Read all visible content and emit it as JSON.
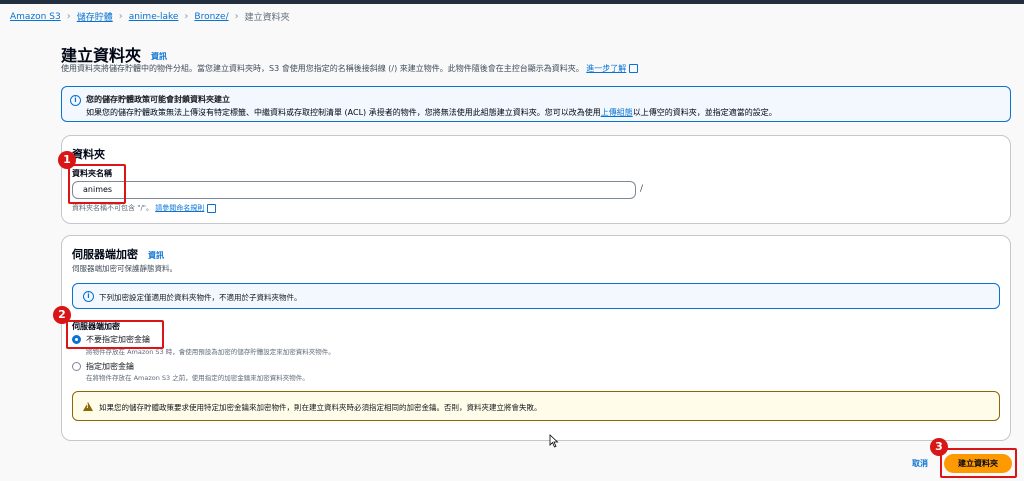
{
  "breadcrumb": {
    "items": [
      "Amazon S3",
      "儲存貯體",
      "anime-lake",
      "Bronze/"
    ],
    "current": "建立資料夾"
  },
  "header": {
    "title": "建立資料夾",
    "info": "資訊",
    "description": "使用資料夾將儲存貯體中的物件分組。當您建立資料夾時，S3 會使用您指定的名稱後接斜線 (/) 來建立物件。此物件隨後會在主控台顯示為資料夾。",
    "learn_more": "進一步了解"
  },
  "policy_banner": {
    "title": "您的儲存貯體政策可能會封鎖資料夾建立",
    "text_before": "如果您的儲存貯體政策無法上傳沒有特定標籤、中繼資料或存取控制清單 (ACL) 承授者的物件，您將無法使用此組態建立資料夾。您可以改為使用",
    "link": "上傳組態",
    "text_after": "以上傳空的資料夾，並指定適當的設定。"
  },
  "folder": {
    "title": "資料夾",
    "name_label": "資料夾名稱",
    "name_value": "animes",
    "suffix": "/",
    "hint": "資料夾名稱不可包含 \"/\"。",
    "hint_link": "請參閱命名規則"
  },
  "encryption": {
    "title": "伺服器端加密",
    "info": "資訊",
    "description": "伺服器端加密可保護靜態資料。",
    "notice": "下列加密設定僅適用於資料夾物件，不適用於子資料夾物件。",
    "label": "伺服器端加密",
    "options": [
      {
        "label": "不要指定加密金鑰",
        "desc": "將物件存放在 Amazon S3 時，會使用預設為加密的儲存貯體設定來加密資料夾物件。",
        "checked": true
      },
      {
        "label": "指定加密金鑰",
        "desc": "在將物件存放在 Amazon S3 之前，使用指定的加密金鑰來加密資料夾物件。",
        "checked": false
      }
    ],
    "warning": "如果您的儲存貯體政策要求使用特定加密金鑰來加密物件，則在建立資料夾時必須指定相同的加密金鑰。否則，資料夾建立將會失敗。"
  },
  "footer": {
    "cancel": "取消",
    "create": "建立資料夾"
  },
  "annotations": [
    "1",
    "2",
    "3"
  ]
}
